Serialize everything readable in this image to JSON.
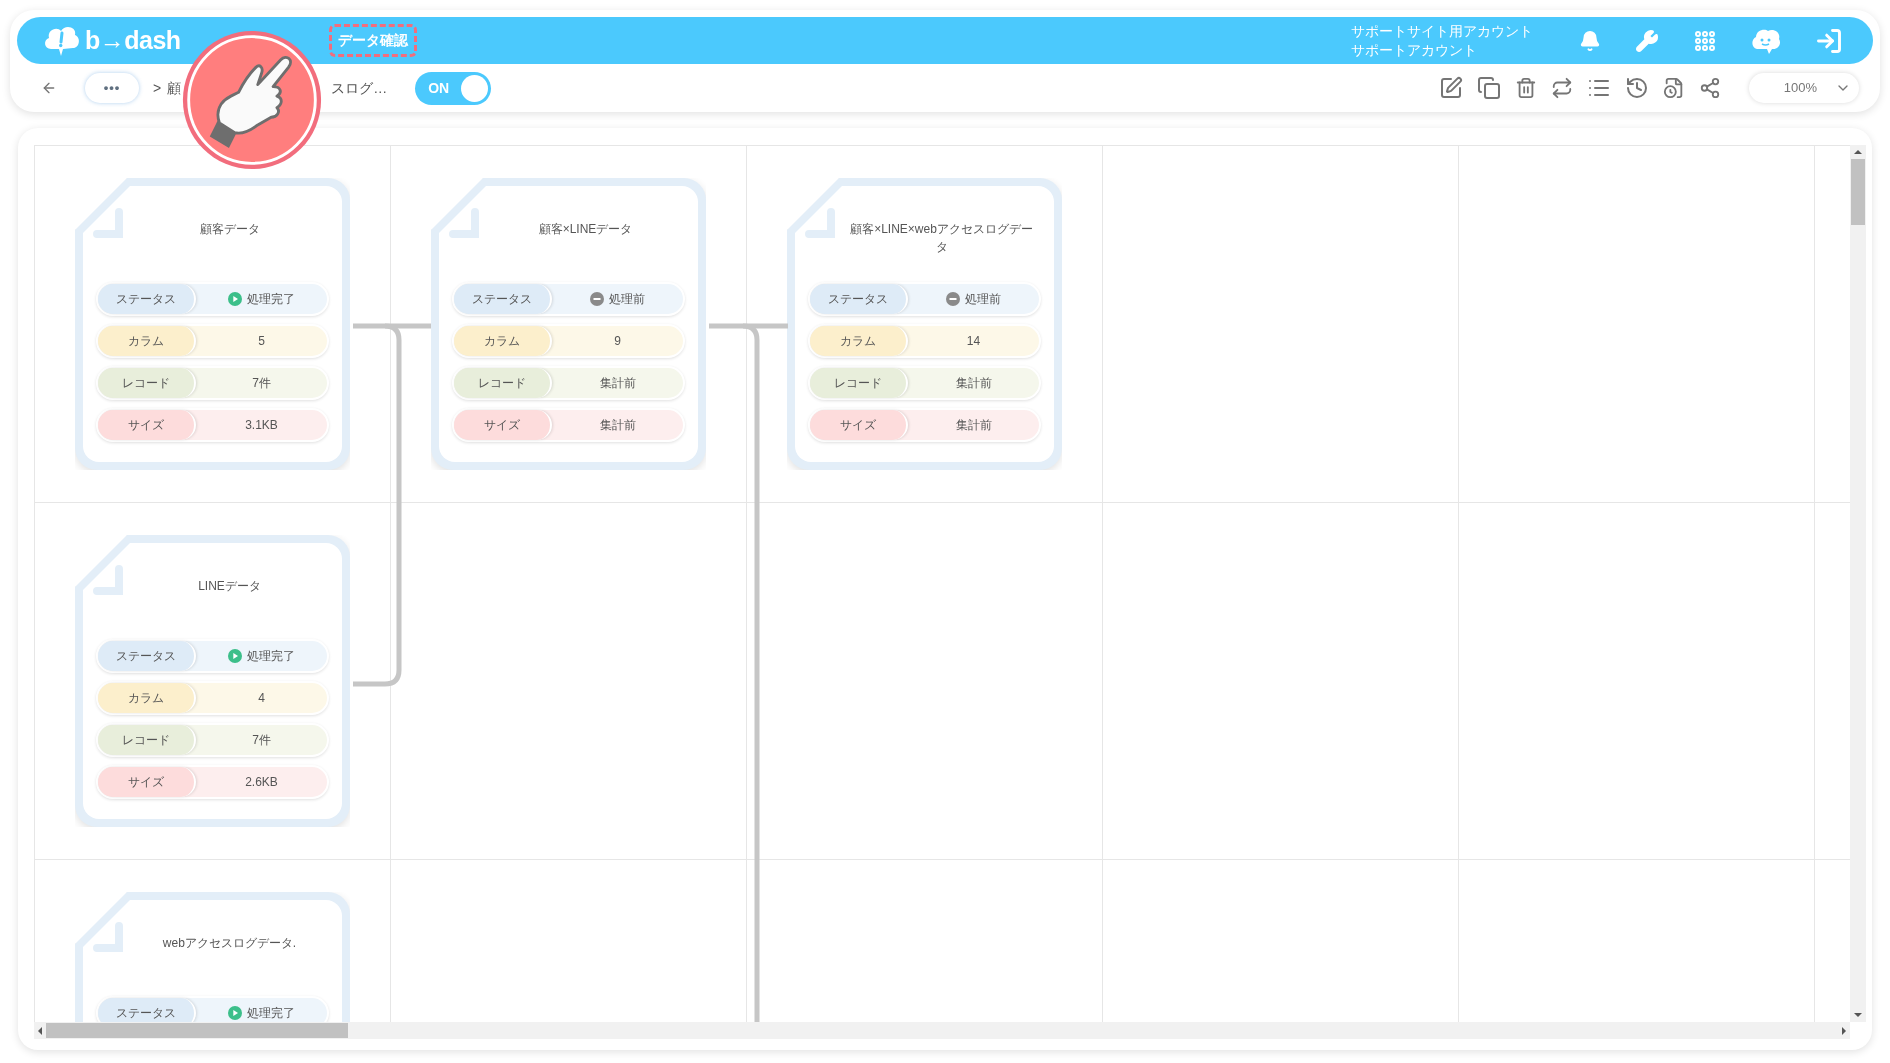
{
  "header": {
    "logo": "b→dash",
    "nav": [
      {
        "label": "データ確認",
        "highlighted": true
      }
    ],
    "account": [
      "サポートサイト用アカウント",
      "サポートアカウント"
    ]
  },
  "toolbar": {
    "more": "•••",
    "separator": ">",
    "breadcrumb_start": "顧",
    "breadcrumb_end": "スログ…",
    "toggle": {
      "label": "ON",
      "on": true
    },
    "zoom": "100%"
  },
  "lanes": [
    {
      "cards": [
        {
          "title": "顧客データ",
          "rows": [
            {
              "kind": "status",
              "label": "ステータス",
              "value": "処理完了",
              "complete": true
            },
            {
              "kind": "columns",
              "label": "カラム",
              "value": "5"
            },
            {
              "kind": "records",
              "label": "レコード",
              "value": "7件"
            },
            {
              "kind": "size",
              "label": "サイズ",
              "value": "3.1KB"
            }
          ]
        },
        {
          "title": "顧客×LINEデータ",
          "rows": [
            {
              "kind": "status",
              "label": "ステータス",
              "value": "処理前",
              "complete": false
            },
            {
              "kind": "columns",
              "label": "カラム",
              "value": "9"
            },
            {
              "kind": "records",
              "label": "レコード",
              "value": "集計前"
            },
            {
              "kind": "size",
              "label": "サイズ",
              "value": "集計前"
            }
          ]
        },
        {
          "title": "顧客×LINE×webアクセスログデータ",
          "rows": [
            {
              "kind": "status",
              "label": "ステータス",
              "value": "処理前",
              "complete": false
            },
            {
              "kind": "columns",
              "label": "カラム",
              "value": "14"
            },
            {
              "kind": "records",
              "label": "レコード",
              "value": "集計前"
            },
            {
              "kind": "size",
              "label": "サイズ",
              "value": "集計前"
            }
          ]
        }
      ]
    },
    {
      "cards": [
        {
          "title": "LINEデータ",
          "rows": [
            {
              "kind": "status",
              "label": "ステータス",
              "value": "処理完了",
              "complete": true
            },
            {
              "kind": "columns",
              "label": "カラム",
              "value": "4"
            },
            {
              "kind": "records",
              "label": "レコード",
              "value": "7件"
            },
            {
              "kind": "size",
              "label": "サイズ",
              "value": "2.6KB"
            }
          ]
        }
      ]
    },
    {
      "cards": [
        {
          "title": "webアクセスログデータ.",
          "rows": [
            {
              "kind": "status",
              "label": "ステータス",
              "value": "処理完了",
              "complete": true
            }
          ]
        }
      ]
    }
  ]
}
